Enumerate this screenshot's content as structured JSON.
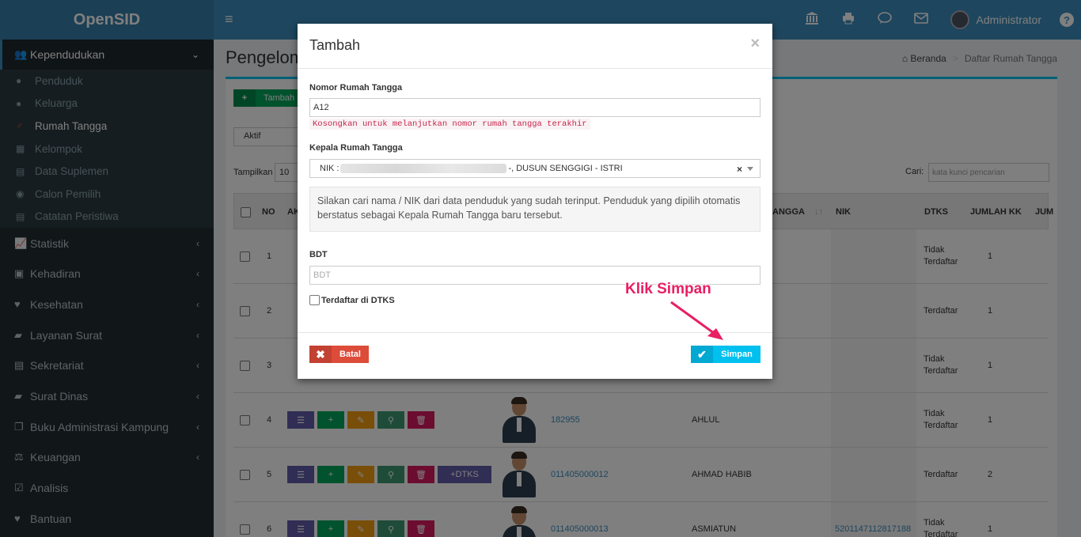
{
  "header": {
    "brand": "OpenSID",
    "user_name": "Administrator",
    "menu_toggle": "≡",
    "icons": [
      "bank-icon",
      "print-icon",
      "comments-icon",
      "envelope-icon"
    ]
  },
  "sidebar": {
    "active": "Kependudukan",
    "sub_items": [
      {
        "label": "Penduduk",
        "icon": "user-icon"
      },
      {
        "label": "Keluarga",
        "icon": "users-icon"
      },
      {
        "label": "Rumah Tangga",
        "icon": "male-icon",
        "active": true
      },
      {
        "label": "Kelompok",
        "icon": "sitemap-icon"
      },
      {
        "label": "Data Suplemen",
        "icon": "archive-icon"
      },
      {
        "label": "Calon Pemilih",
        "icon": "dot-circle-icon"
      },
      {
        "label": "Catatan Peristiwa",
        "icon": "archive-icon"
      }
    ],
    "items": [
      {
        "label": "Statistik",
        "icon": "chart-icon"
      },
      {
        "label": "Kehadiran",
        "icon": "calendar-icon"
      },
      {
        "label": "Kesehatan",
        "icon": "heart-icon"
      },
      {
        "label": "Layanan Surat",
        "icon": "book-icon"
      },
      {
        "label": "Sekretariat",
        "icon": "archive-icon"
      },
      {
        "label": "Surat Dinas",
        "icon": "book-icon"
      },
      {
        "label": "Buku Administrasi Kampung",
        "icon": "copy-icon"
      },
      {
        "label": "Keuangan",
        "icon": "balance-icon"
      },
      {
        "label": "Analisis",
        "icon": "check-square-icon"
      },
      {
        "label": "Bantuan",
        "icon": "heart-icon"
      }
    ]
  },
  "page": {
    "title": "Pengelom",
    "breadcrumb": [
      "Beranda",
      "Daftar Rumah Tangga"
    ],
    "add_label": "Tambah",
    "status_value": "Aktif",
    "length_label": "Tampilkan",
    "length_value": "10",
    "search_label": "Cari:",
    "search_placeholder": "kata kunci pencarian"
  },
  "table": {
    "headers": {
      "no": "NO",
      "aksi": "AK",
      "kk": "ANGGA",
      "nik": "NIK",
      "dtks": "DTKS",
      "jumlah_kk": "JUMLAH KK",
      "jum": "JUM"
    },
    "rows": [
      {
        "no": "1",
        "nomor": "",
        "nama": "",
        "nik": "",
        "dtks": "Tidak Terdaftar",
        "jumlah_kk": "1"
      },
      {
        "no": "2",
        "nomor": "",
        "nama": "",
        "nik": "",
        "dtks": "Terdaftar",
        "jumlah_kk": "1"
      },
      {
        "no": "3",
        "nomor": "",
        "nama": "",
        "nik": "",
        "dtks": "Tidak Terdaftar",
        "jumlah_kk": "1"
      },
      {
        "no": "4",
        "nomor": "182955",
        "nama": "AHLUL",
        "nik": "",
        "dtks": "Tidak Terdaftar",
        "jumlah_kk": "1"
      },
      {
        "no": "5",
        "nomor": "011405000012",
        "nama": "AHMAD HABIB",
        "nik": "",
        "dtks": "Terdaftar",
        "jumlah_kk": "2",
        "dtks_button": "DTKS"
      },
      {
        "no": "6",
        "nomor": "011405000013",
        "nama": "ASMIATUN",
        "nik": "5201147112817188",
        "dtks": "Tidak Terdaftar",
        "jumlah_kk": "1"
      }
    ]
  },
  "modal": {
    "title": "Tambah",
    "close": "×",
    "nomor_label": "Nomor Rumah Tangga",
    "nomor_value": "A12",
    "nomor_hint": "Kosongkan untuk melanjutkan nomor rumah tangga terakhir",
    "kepala_label": "Kepala Rumah Tangga",
    "kepala_prefix": "NIK :",
    "kepala_suffix": "-, DUSUN SENGGIGI - ISTRI",
    "clear": "×",
    "info": "Silakan cari nama / NIK dari data penduduk yang sudah terinput. Penduduk yang dipilih otomatis berstatus sebagai Kepala Rumah Tangga baru tersebut.",
    "bdt_label": "BDT",
    "bdt_placeholder": "BDT",
    "dtks_checkbox": "Terdaftar di DTKS",
    "cancel": "Batal",
    "save": "Simpan"
  },
  "annotation": "Klik Simpan",
  "colors": {
    "header": "#3c8dbc",
    "sidebar": "#222d32",
    "annotation": "#e91e63",
    "save": "#00c0ef",
    "cancel": "#dd4b39"
  }
}
